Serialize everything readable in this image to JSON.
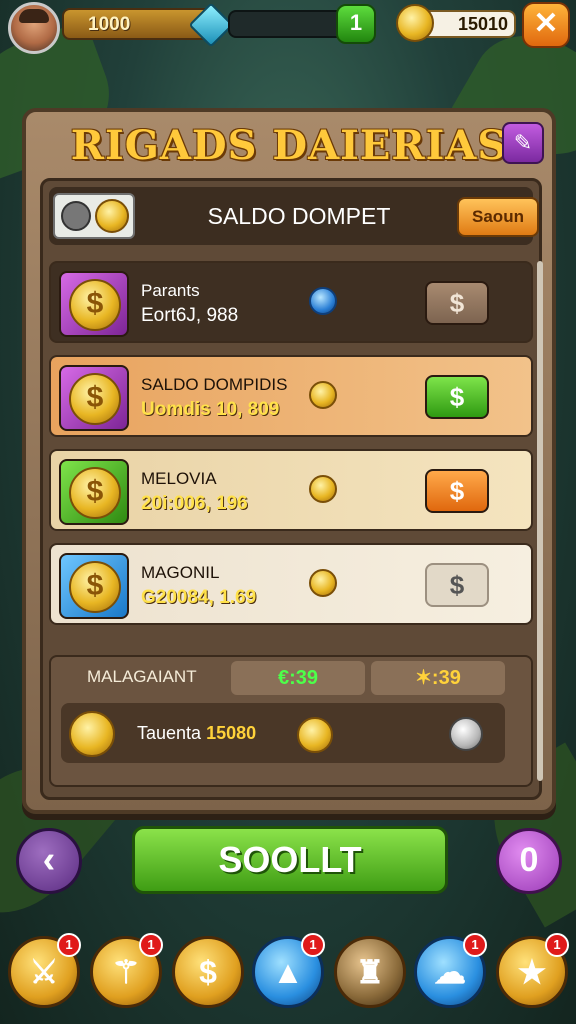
{
  "topbar": {
    "xp_value": "1000",
    "level_value": "0",
    "level_badge": "1",
    "coins_value": "15010",
    "close_label": "✕"
  },
  "panel": {
    "title": "RIGADS DAIERIAS",
    "edit_icon": "✎",
    "header_title": "SALDO DOMPET",
    "header_button": "Saoun"
  },
  "rows": [
    {
      "name": "Parants",
      "value": "Eort6J, 988",
      "button": "$",
      "accent": "#c55ad8"
    },
    {
      "name": "SALDO DOMPIDIS",
      "value": "Uomdis 10, 809",
      "button": "$",
      "accent": "#c55ad8"
    },
    {
      "name": "MELOVIA",
      "value": "20i:006, 196",
      "button": "$",
      "accent": "#4caf22"
    },
    {
      "name": "MAGONIL",
      "value": "G20084, 1.69",
      "button": "$",
      "accent": "#2e9ae0"
    }
  ],
  "summary": {
    "label": "MALAGAIANT",
    "green_value": "€:39",
    "gold_value": "✶:39",
    "total_label": "Tauenta",
    "total_value": "15080"
  },
  "actions": {
    "back_label": "‹",
    "submit_label": "SOOLLT",
    "info_label": "0"
  },
  "nav": [
    {
      "name": "nav-sword",
      "glyph": "⚔",
      "badge": "1"
    },
    {
      "name": "nav-letter",
      "glyph": "⚚",
      "badge": "1"
    },
    {
      "name": "nav-coin",
      "glyph": "$",
      "badge": ""
    },
    {
      "name": "nav-up",
      "glyph": "▲",
      "badge": "1"
    },
    {
      "name": "nav-hero",
      "glyph": "♜",
      "badge": ""
    },
    {
      "name": "nav-ghost",
      "glyph": "☁",
      "badge": "1"
    },
    {
      "name": "nav-star",
      "glyph": "★",
      "badge": "1"
    }
  ]
}
